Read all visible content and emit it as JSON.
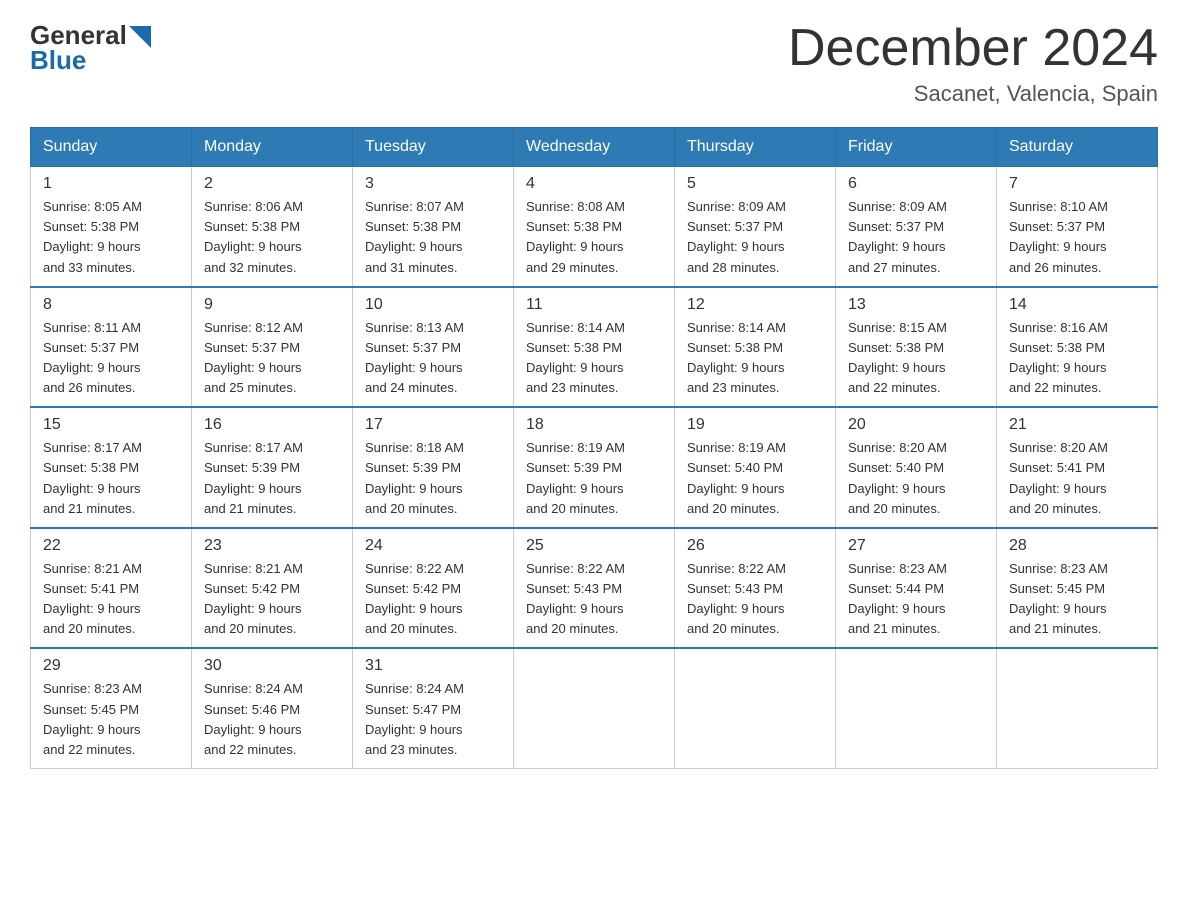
{
  "logo": {
    "general": "General",
    "blue": "Blue",
    "triangle_color": "#1a6baa"
  },
  "header": {
    "month_year": "December 2024",
    "location": "Sacanet, Valencia, Spain"
  },
  "days_of_week": [
    "Sunday",
    "Monday",
    "Tuesday",
    "Wednesday",
    "Thursday",
    "Friday",
    "Saturday"
  ],
  "weeks": [
    [
      {
        "day": "1",
        "sunrise": "Sunrise: 8:05 AM",
        "sunset": "Sunset: 5:38 PM",
        "daylight": "Daylight: 9 hours",
        "daylight2": "and 33 minutes."
      },
      {
        "day": "2",
        "sunrise": "Sunrise: 8:06 AM",
        "sunset": "Sunset: 5:38 PM",
        "daylight": "Daylight: 9 hours",
        "daylight2": "and 32 minutes."
      },
      {
        "day": "3",
        "sunrise": "Sunrise: 8:07 AM",
        "sunset": "Sunset: 5:38 PM",
        "daylight": "Daylight: 9 hours",
        "daylight2": "and 31 minutes."
      },
      {
        "day": "4",
        "sunrise": "Sunrise: 8:08 AM",
        "sunset": "Sunset: 5:38 PM",
        "daylight": "Daylight: 9 hours",
        "daylight2": "and 29 minutes."
      },
      {
        "day": "5",
        "sunrise": "Sunrise: 8:09 AM",
        "sunset": "Sunset: 5:37 PM",
        "daylight": "Daylight: 9 hours",
        "daylight2": "and 28 minutes."
      },
      {
        "day": "6",
        "sunrise": "Sunrise: 8:09 AM",
        "sunset": "Sunset: 5:37 PM",
        "daylight": "Daylight: 9 hours",
        "daylight2": "and 27 minutes."
      },
      {
        "day": "7",
        "sunrise": "Sunrise: 8:10 AM",
        "sunset": "Sunset: 5:37 PM",
        "daylight": "Daylight: 9 hours",
        "daylight2": "and 26 minutes."
      }
    ],
    [
      {
        "day": "8",
        "sunrise": "Sunrise: 8:11 AM",
        "sunset": "Sunset: 5:37 PM",
        "daylight": "Daylight: 9 hours",
        "daylight2": "and 26 minutes."
      },
      {
        "day": "9",
        "sunrise": "Sunrise: 8:12 AM",
        "sunset": "Sunset: 5:37 PM",
        "daylight": "Daylight: 9 hours",
        "daylight2": "and 25 minutes."
      },
      {
        "day": "10",
        "sunrise": "Sunrise: 8:13 AM",
        "sunset": "Sunset: 5:37 PM",
        "daylight": "Daylight: 9 hours",
        "daylight2": "and 24 minutes."
      },
      {
        "day": "11",
        "sunrise": "Sunrise: 8:14 AM",
        "sunset": "Sunset: 5:38 PM",
        "daylight": "Daylight: 9 hours",
        "daylight2": "and 23 minutes."
      },
      {
        "day": "12",
        "sunrise": "Sunrise: 8:14 AM",
        "sunset": "Sunset: 5:38 PM",
        "daylight": "Daylight: 9 hours",
        "daylight2": "and 23 minutes."
      },
      {
        "day": "13",
        "sunrise": "Sunrise: 8:15 AM",
        "sunset": "Sunset: 5:38 PM",
        "daylight": "Daylight: 9 hours",
        "daylight2": "and 22 minutes."
      },
      {
        "day": "14",
        "sunrise": "Sunrise: 8:16 AM",
        "sunset": "Sunset: 5:38 PM",
        "daylight": "Daylight: 9 hours",
        "daylight2": "and 22 minutes."
      }
    ],
    [
      {
        "day": "15",
        "sunrise": "Sunrise: 8:17 AM",
        "sunset": "Sunset: 5:38 PM",
        "daylight": "Daylight: 9 hours",
        "daylight2": "and 21 minutes."
      },
      {
        "day": "16",
        "sunrise": "Sunrise: 8:17 AM",
        "sunset": "Sunset: 5:39 PM",
        "daylight": "Daylight: 9 hours",
        "daylight2": "and 21 minutes."
      },
      {
        "day": "17",
        "sunrise": "Sunrise: 8:18 AM",
        "sunset": "Sunset: 5:39 PM",
        "daylight": "Daylight: 9 hours",
        "daylight2": "and 20 minutes."
      },
      {
        "day": "18",
        "sunrise": "Sunrise: 8:19 AM",
        "sunset": "Sunset: 5:39 PM",
        "daylight": "Daylight: 9 hours",
        "daylight2": "and 20 minutes."
      },
      {
        "day": "19",
        "sunrise": "Sunrise: 8:19 AM",
        "sunset": "Sunset: 5:40 PM",
        "daylight": "Daylight: 9 hours",
        "daylight2": "and 20 minutes."
      },
      {
        "day": "20",
        "sunrise": "Sunrise: 8:20 AM",
        "sunset": "Sunset: 5:40 PM",
        "daylight": "Daylight: 9 hours",
        "daylight2": "and 20 minutes."
      },
      {
        "day": "21",
        "sunrise": "Sunrise: 8:20 AM",
        "sunset": "Sunset: 5:41 PM",
        "daylight": "Daylight: 9 hours",
        "daylight2": "and 20 minutes."
      }
    ],
    [
      {
        "day": "22",
        "sunrise": "Sunrise: 8:21 AM",
        "sunset": "Sunset: 5:41 PM",
        "daylight": "Daylight: 9 hours",
        "daylight2": "and 20 minutes."
      },
      {
        "day": "23",
        "sunrise": "Sunrise: 8:21 AM",
        "sunset": "Sunset: 5:42 PM",
        "daylight": "Daylight: 9 hours",
        "daylight2": "and 20 minutes."
      },
      {
        "day": "24",
        "sunrise": "Sunrise: 8:22 AM",
        "sunset": "Sunset: 5:42 PM",
        "daylight": "Daylight: 9 hours",
        "daylight2": "and 20 minutes."
      },
      {
        "day": "25",
        "sunrise": "Sunrise: 8:22 AM",
        "sunset": "Sunset: 5:43 PM",
        "daylight": "Daylight: 9 hours",
        "daylight2": "and 20 minutes."
      },
      {
        "day": "26",
        "sunrise": "Sunrise: 8:22 AM",
        "sunset": "Sunset: 5:43 PM",
        "daylight": "Daylight: 9 hours",
        "daylight2": "and 20 minutes."
      },
      {
        "day": "27",
        "sunrise": "Sunrise: 8:23 AM",
        "sunset": "Sunset: 5:44 PM",
        "daylight": "Daylight: 9 hours",
        "daylight2": "and 21 minutes."
      },
      {
        "day": "28",
        "sunrise": "Sunrise: 8:23 AM",
        "sunset": "Sunset: 5:45 PM",
        "daylight": "Daylight: 9 hours",
        "daylight2": "and 21 minutes."
      }
    ],
    [
      {
        "day": "29",
        "sunrise": "Sunrise: 8:23 AM",
        "sunset": "Sunset: 5:45 PM",
        "daylight": "Daylight: 9 hours",
        "daylight2": "and 22 minutes."
      },
      {
        "day": "30",
        "sunrise": "Sunrise: 8:24 AM",
        "sunset": "Sunset: 5:46 PM",
        "daylight": "Daylight: 9 hours",
        "daylight2": "and 22 minutes."
      },
      {
        "day": "31",
        "sunrise": "Sunrise: 8:24 AM",
        "sunset": "Sunset: 5:47 PM",
        "daylight": "Daylight: 9 hours",
        "daylight2": "and 23 minutes."
      },
      null,
      null,
      null,
      null
    ]
  ]
}
